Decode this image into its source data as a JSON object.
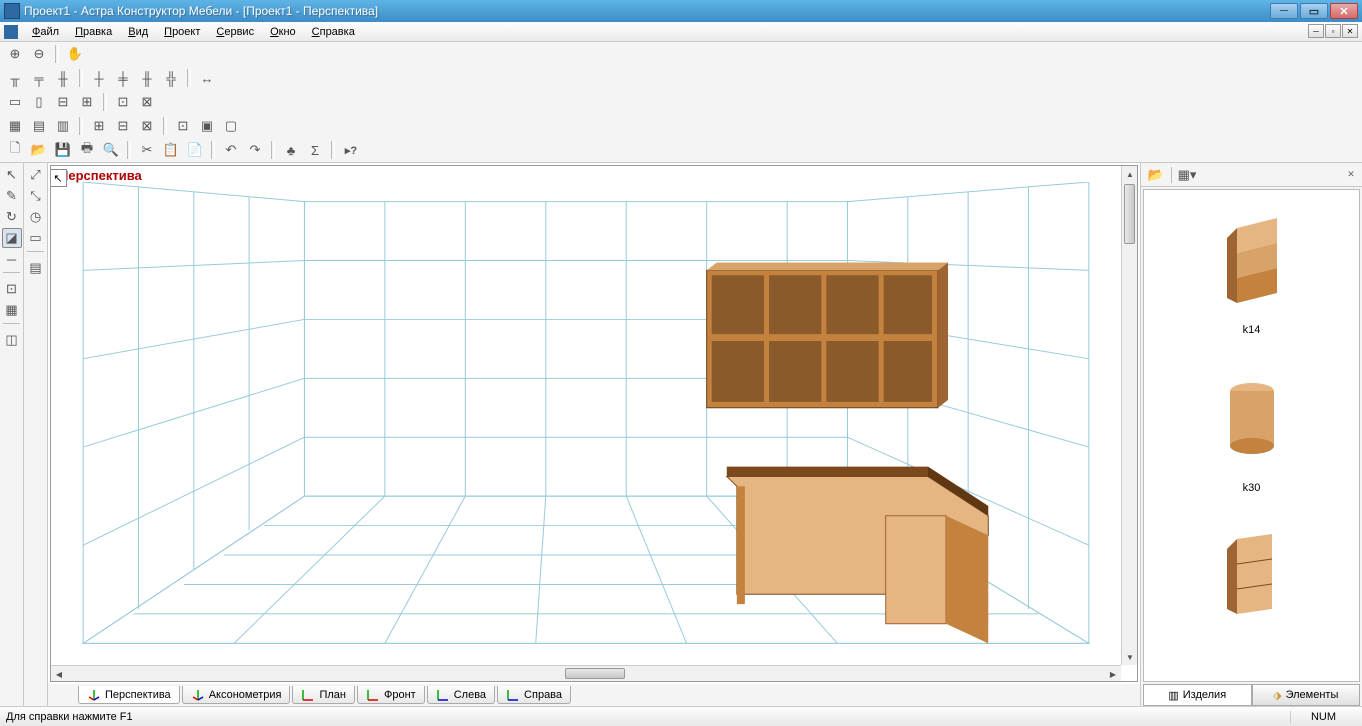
{
  "titlebar": {
    "title": "Проект1 - Астра Конструктор Мебели - [Проект1 - Перспектива]"
  },
  "menu": {
    "file": "Файл",
    "edit": "Правка",
    "view": "Вид",
    "project": "Проект",
    "service": "Сервис",
    "window": "Окно",
    "help": "Справка"
  },
  "viewport": {
    "label": "Перспектива"
  },
  "view_tabs": [
    {
      "label": "Перспектива"
    },
    {
      "label": "Аксонометрия"
    },
    {
      "label": "План"
    },
    {
      "label": "Фронт"
    },
    {
      "label": "Слева"
    },
    {
      "label": "Справа"
    }
  ],
  "library": {
    "items": [
      {
        "label": "k14"
      },
      {
        "label": "k30"
      },
      {
        "label": ""
      }
    ]
  },
  "right_tabs": {
    "products": "Изделия",
    "elements": "Элементы"
  },
  "statusbar": {
    "hint": "Для справки нажмите F1",
    "num": "NUM"
  }
}
